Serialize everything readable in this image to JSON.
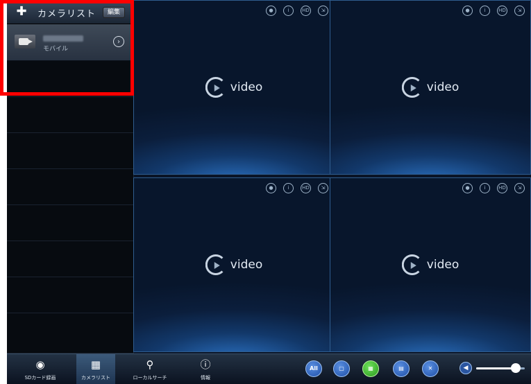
{
  "sidebar": {
    "add_icon": "plus-icon",
    "title": "カメラリスト",
    "edit_label": "編集",
    "cameras": [
      {
        "subtitle": "モバイル",
        "arrow_icon": "chevron-right-circle-icon"
      }
    ]
  },
  "video_panes": [
    {
      "label": "video",
      "icons": [
        "record-icon",
        "info-icon",
        "hd-icon",
        "expand-icon"
      ]
    },
    {
      "label": "video",
      "icons": [
        "record-icon",
        "info-icon",
        "hd-icon",
        "expand-icon"
      ]
    },
    {
      "label": "video",
      "icons": [
        "record-icon",
        "info-icon",
        "hd-icon",
        "expand-icon"
      ]
    },
    {
      "label": "video",
      "icons": [
        "record-icon",
        "info-icon",
        "hd-icon",
        "expand-icon"
      ]
    }
  ],
  "bottom_tabs": [
    {
      "label": "SDカード録画",
      "icon": "sd-record-icon",
      "glyph": "◉"
    },
    {
      "label": "カメラリスト",
      "icon": "camera-list-icon",
      "glyph": "▦"
    },
    {
      "label": "ローカルサーチ",
      "icon": "search-icon",
      "glyph": "⚲"
    },
    {
      "label": "情報",
      "icon": "info-icon",
      "glyph": "ⓘ"
    }
  ],
  "controls": {
    "all_label": "All",
    "volume_level": 0.82
  },
  "colors": {
    "highlight": "#ff0000",
    "accent": "#2a6fbf",
    "grid_button": "#2a9a1e"
  }
}
